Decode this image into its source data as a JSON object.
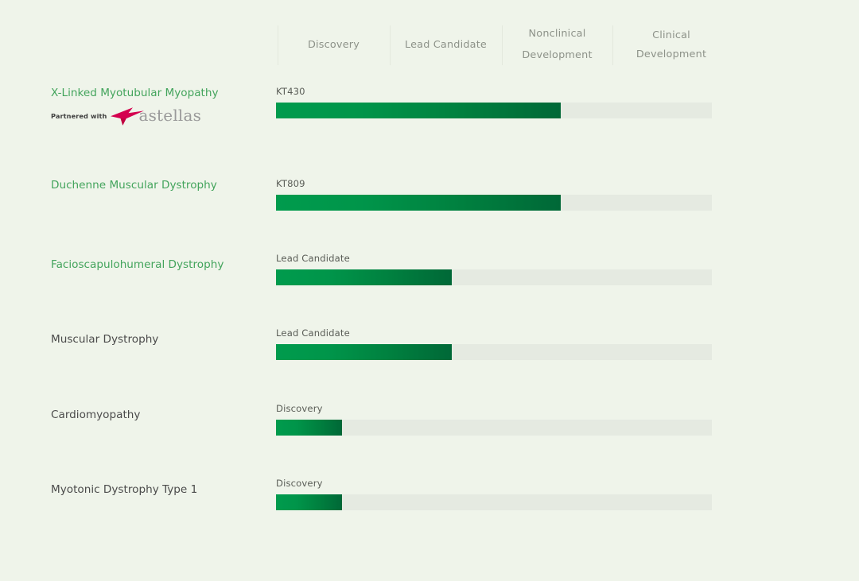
{
  "palette": {
    "page_background": "#eff4ea",
    "track": "#e5eae1",
    "bar_start": "#009b4d",
    "bar_end": "#006837",
    "name_green": "#43a45c",
    "name_gray": "#4b4b4b",
    "header_text": "#8d9289",
    "stage_text": "#5a5d57",
    "partner_logo_red": "#d4004f"
  },
  "header": {
    "stages": [
      {
        "label": "Discovery"
      },
      {
        "label": "Lead Candidate"
      },
      {
        "label": "Nonclinical Development"
      },
      {
        "label": "Clinical Development"
      }
    ]
  },
  "chart_data": {
    "type": "bar",
    "title": "",
    "xlabel": "",
    "ylabel": "",
    "orientation": "horizontal",
    "grid": false,
    "legend": "none",
    "stage_axis": [
      "Discovery",
      "Lead Candidate",
      "Nonclinical Development",
      "Clinical Development"
    ],
    "xlim": [
      0,
      100
    ],
    "categories": [
      "X-Linked Myotubular Myopathy",
      "Duchenne Muscular Dystrophy",
      "Facioscapulohumeral Dystrophy",
      "Muscular Dystrophy",
      "Cardiomyopathy",
      "Myotonic Dystrophy Type 1"
    ],
    "values": [
      65.3,
      65.3,
      40.3,
      40.3,
      15.1,
      15.1
    ],
    "value_stage_labels": [
      "Nonclinical Development",
      "Nonclinical Development",
      "Lead Candidate",
      "Lead Candidate",
      "Discovery",
      "Discovery"
    ],
    "bar_annotations": [
      "KT430",
      "KT809",
      "Lead Candidate",
      "Lead Candidate",
      "Discovery",
      "Discovery"
    ]
  },
  "rows": [
    {
      "name": "X-Linked Myotubular Myopathy",
      "name_style": "green",
      "stage_label": "KT430",
      "progress_pct": 65.3,
      "partner": {
        "prefix": "Partnered with",
        "brand": "astellas",
        "logo_icon": "astellas-star-icon"
      }
    },
    {
      "name": "Duchenne Muscular Dystrophy",
      "name_style": "green",
      "stage_label": "KT809",
      "progress_pct": 65.3,
      "partner": null
    },
    {
      "name": "Facioscapulohumeral Dystrophy",
      "name_style": "green",
      "stage_label": "Lead Candidate",
      "progress_pct": 40.3,
      "partner": null
    },
    {
      "name": "Muscular Dystrophy",
      "name_style": "gray",
      "stage_label": "Lead Candidate",
      "progress_pct": 40.3,
      "partner": null
    },
    {
      "name": "Cardiomyopathy",
      "name_style": "gray",
      "stage_label": "Discovery",
      "progress_pct": 15.1,
      "partner": null
    },
    {
      "name": "Myotonic Dystrophy Type 1",
      "name_style": "gray",
      "stage_label": "Discovery",
      "progress_pct": 15.1,
      "partner": null
    }
  ]
}
